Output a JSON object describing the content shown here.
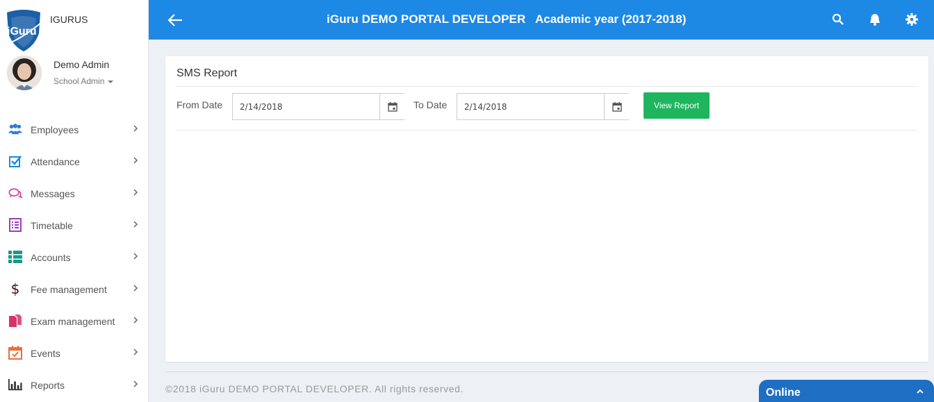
{
  "sidebar": {
    "brand_name": "IGURUS",
    "logo_text": "iGuru",
    "profile": {
      "name": "Demo Admin",
      "role": "School Admin"
    },
    "items": [
      {
        "label": "Employees",
        "icon": "users-icon",
        "color": "#2f7bd3"
      },
      {
        "label": "Attendance",
        "icon": "checkbox-icon",
        "color": "#1e88e5"
      },
      {
        "label": "Messages",
        "icon": "chat-bubbles-icon",
        "color": "#d63aa0"
      },
      {
        "label": "Timetable",
        "icon": "list-icon",
        "color": "#9b3fb4"
      },
      {
        "label": "Accounts",
        "icon": "table-icon",
        "color": "#159a8a"
      },
      {
        "label": "Fee management",
        "icon": "dollar-icon",
        "color": "#3a1010"
      },
      {
        "label": "Exam management",
        "icon": "documents-icon",
        "color": "#d6336c"
      },
      {
        "label": "Events",
        "icon": "calendar-check-icon",
        "color": "#e8703a"
      },
      {
        "label": "Reports",
        "icon": "bar-chart-icon",
        "color": "#333333"
      }
    ]
  },
  "header": {
    "portal_title": "iGuru DEMO PORTAL DEVELOPER",
    "academic_year": "Academic year (2017-2018)",
    "color": "#1e88e5"
  },
  "report": {
    "title": "SMS Report",
    "from_label": "From Date",
    "from_value": "2/14/2018",
    "to_label": "To Date",
    "to_value": "2/14/2018",
    "view_button": "View Report",
    "button_color": "#1fb55e"
  },
  "footer": {
    "copyright": "©2018 iGuru DEMO PORTAL DEVELOPER. All rights reserved.",
    "chat_status": "Online"
  }
}
